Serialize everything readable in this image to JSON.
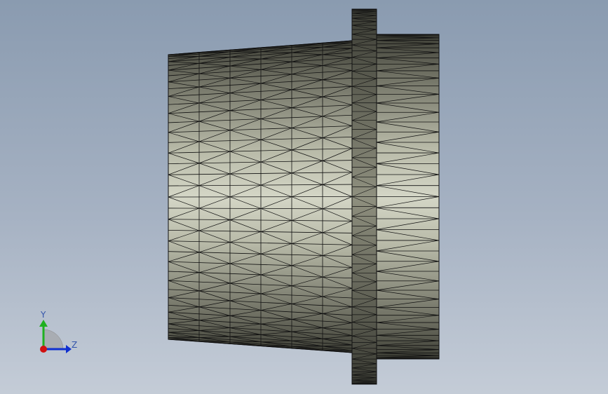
{
  "viewport": {
    "background_top": "#8a9bb0",
    "background_bottom": "#c4ccd7",
    "model": {
      "description_icon": "tessellated-bushing-mesh",
      "face_light": "#d4d6c6",
      "face_dark": "#3e3f36",
      "edge_color": "#111111"
    }
  },
  "triad": {
    "y_label": "Y",
    "z_label": "Z",
    "x_color": "#d01010",
    "y_color": "#20b020",
    "z_color": "#1030d0"
  }
}
